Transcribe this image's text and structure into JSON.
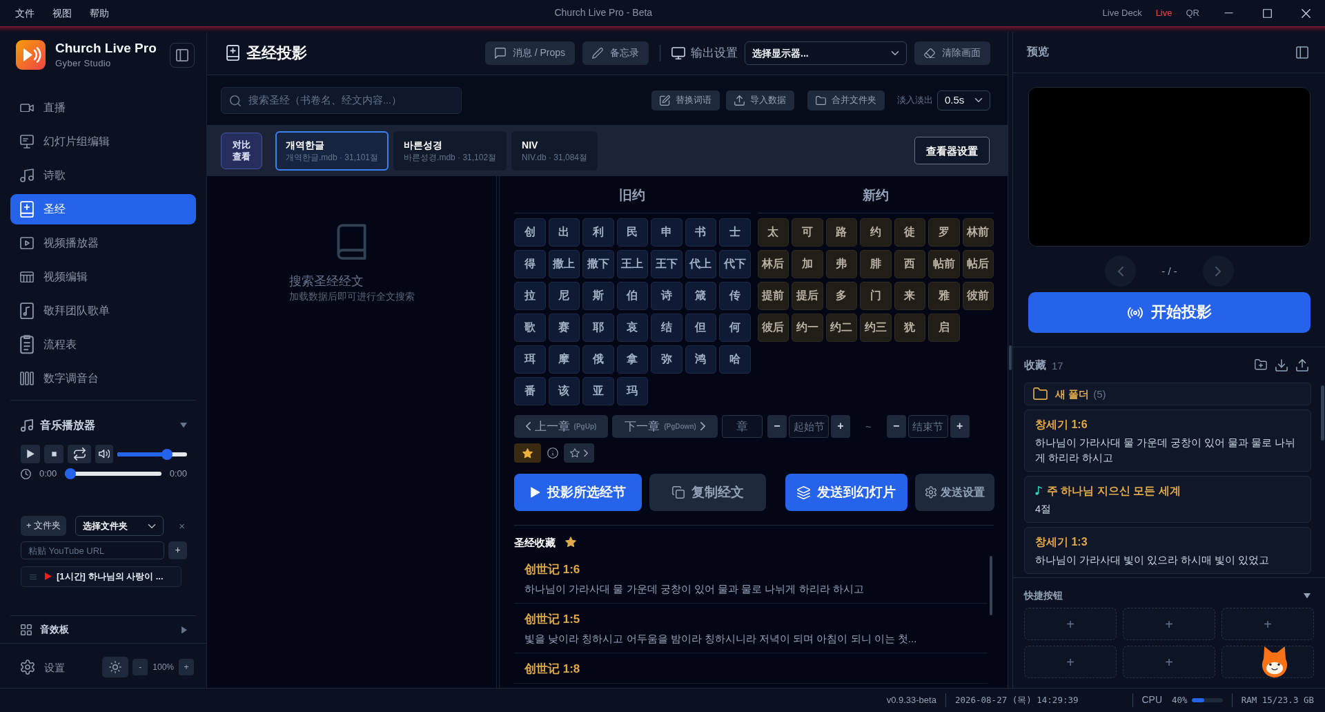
{
  "window": {
    "title": "Church Live Pro - Beta",
    "menu": [
      "文件",
      "视图",
      "帮助"
    ],
    "links": [
      {
        "label": "Live Deck",
        "kind": "link"
      },
      {
        "label": "Live",
        "kind": "live"
      },
      {
        "label": "QR",
        "kind": "link"
      }
    ]
  },
  "sidebar": {
    "app_name": "Church Live Pro",
    "company": "Gyber Studio",
    "items": [
      {
        "label": "直播",
        "kind": "live",
        "selected": false
      },
      {
        "label": "幻灯片组编辑",
        "kind": "slides",
        "selected": false
      },
      {
        "label": "诗歌",
        "kind": "hymns",
        "selected": false
      },
      {
        "label": "圣经",
        "kind": "bible",
        "selected": true
      },
      {
        "label": "视频播放器",
        "kind": "player",
        "selected": false
      },
      {
        "label": "视频编辑",
        "kind": "editor",
        "selected": false
      },
      {
        "label": "敬拜团队歌单",
        "kind": "setlist",
        "selected": false
      },
      {
        "label": "流程表",
        "kind": "rundown",
        "selected": false
      },
      {
        "label": "数字调音台",
        "kind": "mixer",
        "selected": false
      }
    ],
    "music_player": {
      "title": "音乐播放器",
      "expanded": true,
      "volume": {
        "level": 0.75
      },
      "elapsed": "0:00",
      "progress": {
        "level": 0
      },
      "duration": "0:00",
      "folder_button": "+ 文件夹",
      "folder_select": "选择文件夹",
      "clear": "×",
      "url_field": {
        "placeholder": "粘贴 YouTube URL"
      },
      "add_url": "+",
      "playlist": [
        {
          "title": "[1시간] 하나님의 사랑이 ..."
        }
      ]
    },
    "soundboard": {
      "title": "音效板",
      "expanded": false
    },
    "settings": {
      "label": "设置",
      "zoom_out": "-",
      "zoom": "100%",
      "zoom_in": "+"
    }
  },
  "main": {
    "title": "圣经投影",
    "header_buttons": [
      {
        "label": "消息 / Props",
        "kind": "message"
      },
      {
        "label": "备忘录",
        "kind": "memo"
      }
    ],
    "output_label": "输出设置",
    "display_select": "选择显示器...",
    "clear_button": "清除画面",
    "search": {
      "placeholder": "搜索圣经（书卷名、经文内容...）"
    },
    "tools": [
      {
        "label": "替换词语",
        "kind": "replace"
      },
      {
        "label": "导入数据",
        "kind": "import"
      },
      {
        "label": "合并文件夹",
        "kind": "merge"
      }
    ],
    "fade": {
      "label": "淡入淡出",
      "value": "0.5s"
    },
    "compare_button": "对比查看",
    "versions": [
      {
        "name": "개역한글",
        "detail": "개역한글.mdb · 31,101절",
        "selected": true
      },
      {
        "name": "바른성경",
        "detail": "바른성경.mdb · 31,102절",
        "selected": false
      },
      {
        "name": "NIV",
        "detail": "NIV.db · 31,084절",
        "selected": false
      }
    ],
    "viewer_settings": "查看器设置",
    "empty_state": {
      "title": "搜索圣经经文",
      "hint": "加载数据后即可进行全文搜索"
    },
    "testaments": [
      {
        "title": "旧约",
        "kind": "old",
        "books": [
          "创",
          "出",
          "利",
          "民",
          "申",
          "书",
          "士",
          "得",
          "撒上",
          "撒下",
          "王上",
          "王下",
          "代上",
          "代下",
          "拉",
          "尼",
          "斯",
          "伯",
          "诗",
          "箴",
          "传",
          "歌",
          "赛",
          "耶",
          "哀",
          "结",
          "但",
          "何",
          "珥",
          "摩",
          "俄",
          "拿",
          "弥",
          "鸿",
          "哈",
          "番",
          "该",
          "亚",
          "玛"
        ]
      },
      {
        "title": "新约",
        "kind": "new",
        "books": [
          "太",
          "可",
          "路",
          "约",
          "徒",
          "罗",
          "林前",
          "林后",
          "加",
          "弗",
          "腓",
          "西",
          "帖前",
          "帖后",
          "提前",
          "提后",
          "多",
          "门",
          "来",
          "雅",
          "彼前",
          "彼后",
          "约一",
          "约二",
          "约三",
          "犹",
          "启"
        ]
      }
    ],
    "chapter_nav": {
      "prev": "上一章",
      "prev_key": "(PgUp)",
      "next": "下一章",
      "next_key": "(PgDown)",
      "chapter": {
        "placeholder": "章"
      },
      "start_minus": "−",
      "start_verse": {
        "placeholder": "起始节"
      },
      "start_plus": "+",
      "range_sign": "~",
      "end_minus": "−",
      "end_verse": {
        "placeholder": "结束节"
      },
      "end_plus": "+"
    },
    "favorite_filter": {
      "on": true
    },
    "actions": [
      {
        "label": "投影所选经节",
        "kind": "project"
      },
      {
        "label": "复制经文",
        "kind": "copy"
      },
      {
        "label": "发送到幻灯片",
        "kind": "send"
      },
      {
        "label": "发送设置",
        "kind": "settings"
      }
    ],
    "bible_favorites": {
      "title": "圣经收藏",
      "items": [
        {
          "reference": "创世记 1:6",
          "text": "하나님이 가라사대 물 가운데 궁창이 있어 물과 물로 나뉘게 하리라 하시고"
        },
        {
          "reference": "创世记 1:5",
          "text": "빛을 낮이라 칭하시고 어두움을 밤이라 칭하시니라 저녁이 되며 아침이 되니 이는 첫..."
        },
        {
          "reference": "创世记 1:8"
        }
      ]
    }
  },
  "preview": {
    "title": "预览",
    "counter": "- / -",
    "start_button": "开始投影"
  },
  "favorites": {
    "title": "收藏",
    "count": "17",
    "folders": [
      {
        "name": "새 폴더",
        "count": "(5)"
      }
    ],
    "items": [
      {
        "kind": "verse",
        "title": "창세기 1:6",
        "text": "하나님이 가라사대 물 가운데 궁창이 있어 물과 물로 나뉘게 하리라 하시고"
      },
      {
        "kind": "song",
        "title": "주 하나님 지으신 모든 세계",
        "text": "4절"
      },
      {
        "kind": "verse",
        "title": "창세기 1:3",
        "text": "하나님이 가라사대 빛이 있으라 하시매 빛이 있었고"
      }
    ]
  },
  "quick_buttons": {
    "title": "快捷按钮",
    "expanded": true,
    "slots": [
      {
        "kind": "add",
        "label": "+"
      },
      {
        "kind": "add",
        "label": "+"
      },
      {
        "kind": "add",
        "label": "+"
      },
      {
        "kind": "add",
        "label": "+"
      },
      {
        "kind": "add",
        "label": "+"
      },
      {
        "kind": "covered"
      }
    ]
  },
  "status_bar": {
    "version": "v0.9.33-beta",
    "datetime": "2026-08-27 (목) 14:29:39",
    "cpu_label": "CPU",
    "cpu_value": "40%",
    "cpu": {
      "level": 0.4
    },
    "ram": "RAM 15/23.3 GB"
  }
}
